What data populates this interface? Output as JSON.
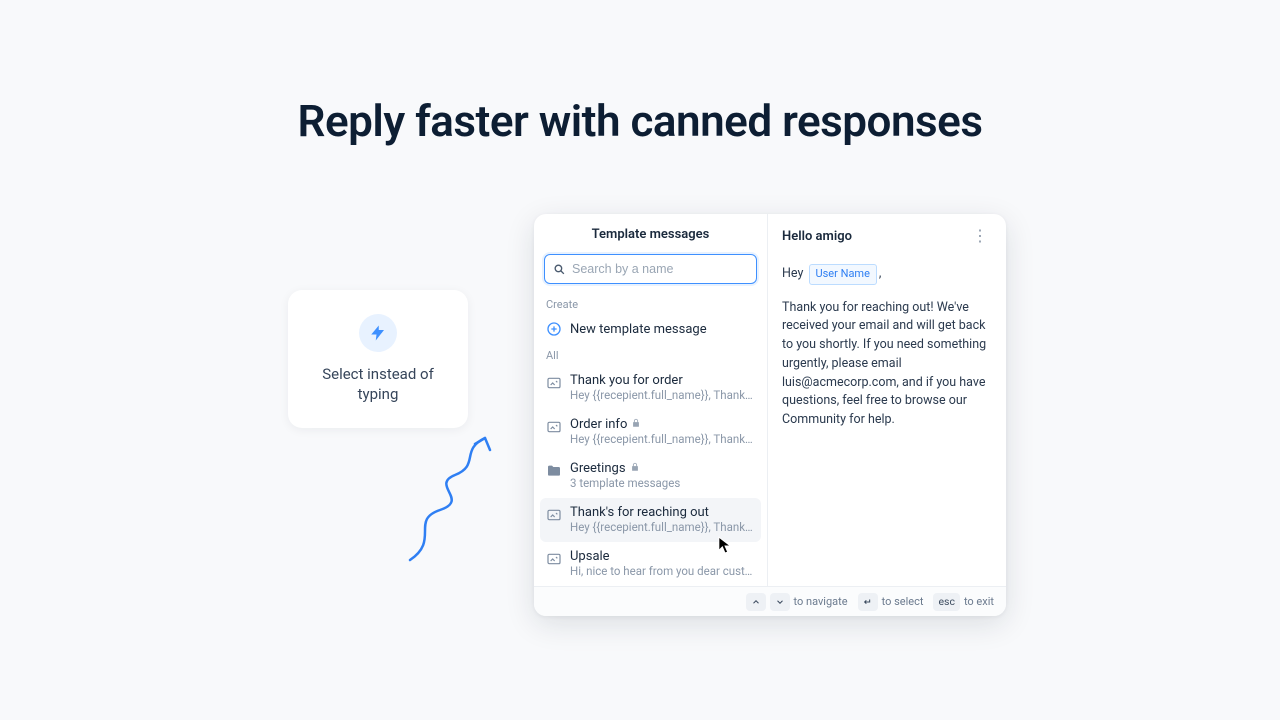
{
  "hero": {
    "title": "Reply faster with canned responses"
  },
  "tagline": {
    "text": "Select instead of typing"
  },
  "left": {
    "header": "Template messages",
    "search_placeholder": "Search by a name",
    "section_create": "Create",
    "create_label": "New template message",
    "section_all": "All",
    "items": [
      {
        "title": "Thank you for order",
        "sub": "Hey {{recepient.full_name}}, Thank you for yo...",
        "locked": false,
        "type": "message"
      },
      {
        "title": "Order info",
        "sub": "Hey {{recepient.full_name}}, Thank you for yo...",
        "locked": true,
        "type": "message"
      },
      {
        "title": "Greetings",
        "sub": "3 template messages",
        "locked": true,
        "type": "folder"
      },
      {
        "title": "Thank's for reaching out",
        "sub": "Hey {{recepient.full_name}}, Thank you for...",
        "locked": false,
        "type": "message",
        "selected": true
      },
      {
        "title": "Upsale",
        "sub": "Hi, nice to hear from you dear customer, how...",
        "locked": false,
        "type": "message"
      }
    ]
  },
  "preview": {
    "title": "Hello amigo",
    "greeting_prefix": "Hey",
    "chip": "User Name",
    "greeting_suffix": ",",
    "body": "Thank you for reaching out! We've received your email and will get back to you shortly. If you need something urgently, please email luis@acmecorp.com, and if you have questions, feel free to browse our Community for help."
  },
  "footer": {
    "navigate": "to navigate",
    "select": "to select",
    "exit": "to exit",
    "esc": "esc"
  }
}
